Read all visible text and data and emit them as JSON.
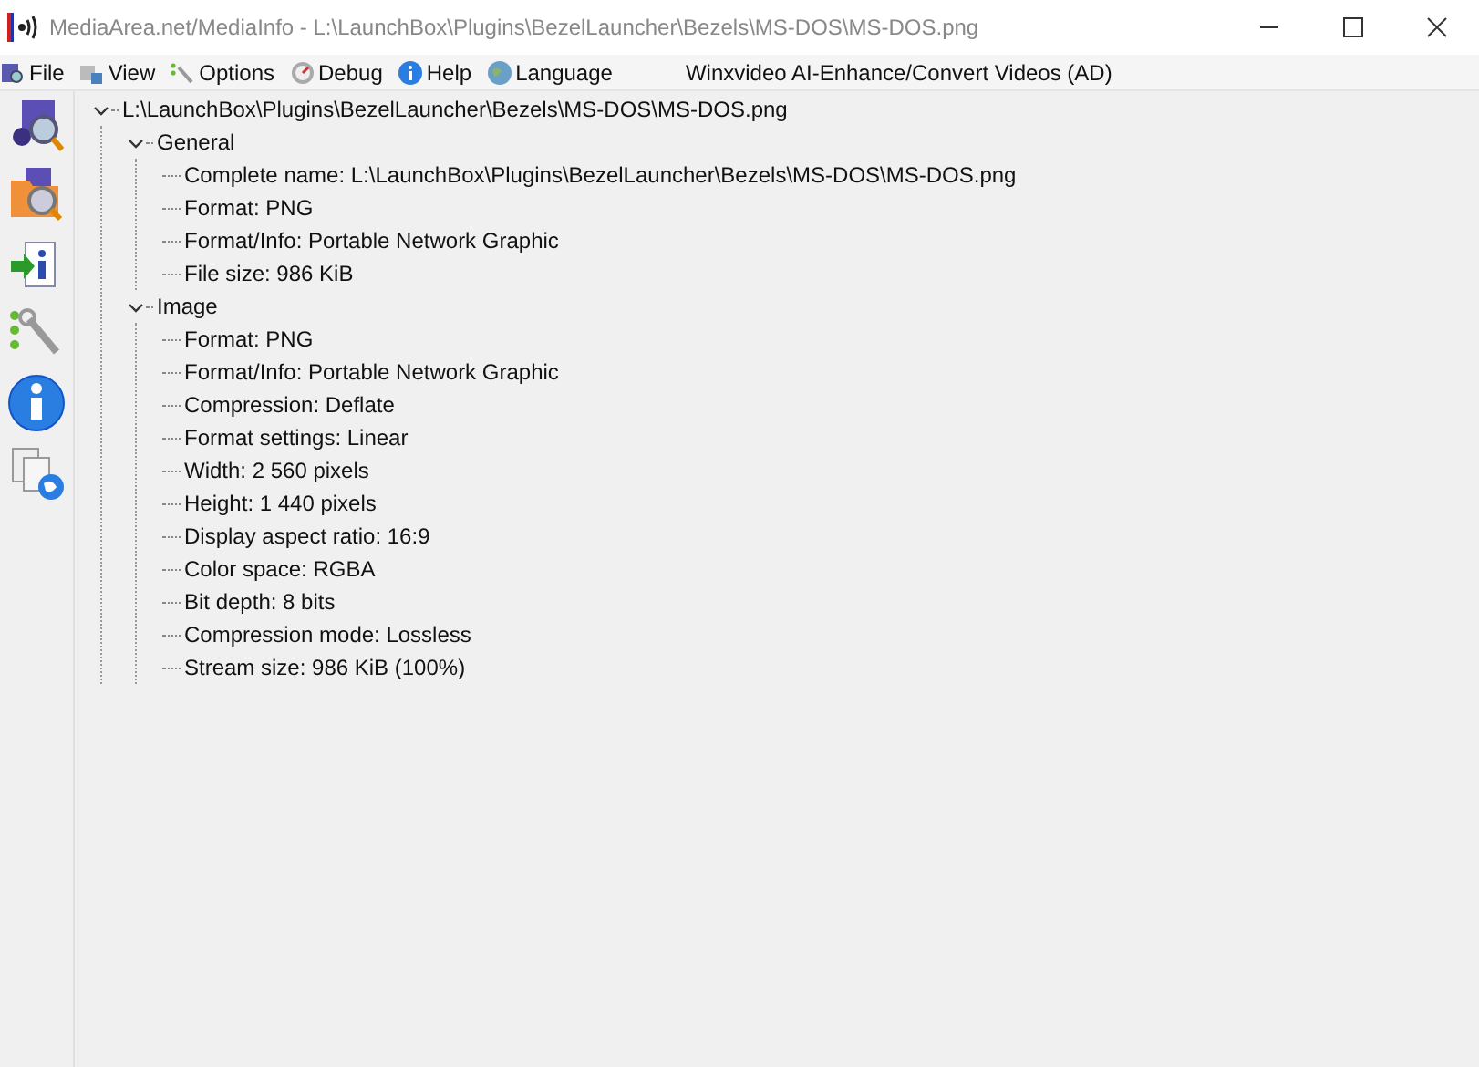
{
  "window": {
    "title": "MediaArea.net/MediaInfo - L:\\LaunchBox\\Plugins\\BezelLauncher\\Bezels\\MS-DOS\\MS-DOS.png"
  },
  "menu": [
    {
      "label": "File",
      "kind": "file"
    },
    {
      "label": "View",
      "kind": "view"
    },
    {
      "label": "Options",
      "kind": "options"
    },
    {
      "label": "Debug",
      "kind": "debug"
    },
    {
      "label": "Help",
      "kind": "help"
    },
    {
      "label": "Language",
      "kind": "language"
    },
    {
      "label": "Winxvideo AI-Enhance/Convert Videos (AD)",
      "kind": "ad"
    }
  ],
  "toolbar": [
    {
      "kind": "open-file"
    },
    {
      "kind": "open-folder"
    },
    {
      "kind": "export"
    },
    {
      "kind": "preferences"
    },
    {
      "kind": "about"
    },
    {
      "kind": "web"
    }
  ],
  "tree": [
    {
      "label": "L:\\LaunchBox\\Plugins\\BezelLauncher\\Bezels\\MS-DOS\\MS-DOS.png",
      "expanded": true,
      "children": [
        {
          "label": "General",
          "expanded": true,
          "children": [
            {
              "label": "Complete name: L:\\LaunchBox\\Plugins\\BezelLauncher\\Bezels\\MS-DOS\\MS-DOS.png"
            },
            {
              "label": "Format: PNG"
            },
            {
              "label": "Format/Info: Portable Network Graphic"
            },
            {
              "label": "File size: 986 KiB"
            }
          ]
        },
        {
          "label": "Image",
          "expanded": true,
          "children": [
            {
              "label": "Format: PNG"
            },
            {
              "label": "Format/Info: Portable Network Graphic"
            },
            {
              "label": "Compression: Deflate"
            },
            {
              "label": "Format settings: Linear"
            },
            {
              "label": "Width: 2 560 pixels"
            },
            {
              "label": "Height: 1 440 pixels"
            },
            {
              "label": "Display aspect ratio: 16:9"
            },
            {
              "label": "Color space: RGBA"
            },
            {
              "label": "Bit depth: 8 bits"
            },
            {
              "label": "Compression mode: Lossless"
            },
            {
              "label": "Stream size: 986 KiB (100%)"
            }
          ]
        }
      ]
    }
  ]
}
